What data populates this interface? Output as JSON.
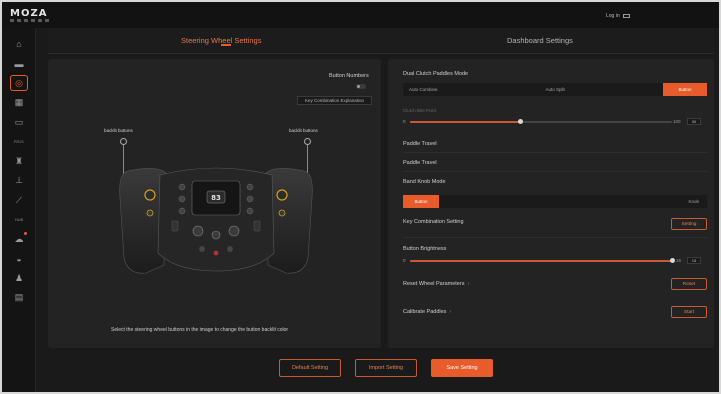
{
  "app": {
    "logo": "MOZA",
    "login": "Log in"
  },
  "sidebar": {
    "items": [
      {
        "icon": "home-icon",
        "glyph": "⌂",
        "label": ""
      },
      {
        "icon": "camera-icon",
        "glyph": "▬",
        "label": ""
      },
      {
        "icon": "steering-wheel-icon",
        "glyph": "◎",
        "label": "",
        "active": true
      },
      {
        "icon": "dashboard-icon",
        "glyph": "▦",
        "label": ""
      },
      {
        "icon": "display-icon",
        "glyph": "▭",
        "label": ""
      },
      {
        "icon": "base-icon",
        "glyph": "",
        "label": "RS21"
      },
      {
        "icon": "shifter-icon",
        "glyph": "♜",
        "label": ""
      },
      {
        "icon": "handbrake-icon",
        "glyph": "⊥",
        "label": ""
      },
      {
        "icon": "pedal-icon",
        "glyph": "⟋",
        "label": ""
      },
      {
        "icon": "hub-icon",
        "glyph": "",
        "label": "HUB"
      },
      {
        "icon": "cloud-icon",
        "glyph": "☁",
        "label": "",
        "badge": true
      },
      {
        "icon": "gear-knob-icon",
        "glyph": "◒",
        "label": ""
      },
      {
        "icon": "user-icon",
        "glyph": "♟",
        "label": ""
      },
      {
        "icon": "list-icon",
        "glyph": "▤",
        "label": ""
      }
    ]
  },
  "tabs": [
    {
      "label": "Steering Wheel Settings",
      "active": true
    },
    {
      "label": "Dashboard Settings",
      "active": false
    }
  ],
  "left_panel": {
    "button_numbers_label": "Button Numbers",
    "key_combination_explanation": "Key Combination Explanation",
    "backlit_left": "backlit buttons",
    "backlit_right": "backlit buttons",
    "display_value": "83",
    "hint": "Select the steering wheel buttons in the image to change the button backlit color"
  },
  "right_panel": {
    "dual_clutch_label": "Dual Clutch Paddles Mode",
    "dual_clutch_options": [
      "Auto Combine",
      "Auto Split",
      "Button"
    ],
    "dual_clutch_active": 2,
    "clutch_bite_label": "Clutch Bite Point",
    "clutch_bite_min": "0",
    "clutch_bite_max": "100",
    "clutch_bite_value": "30",
    "clutch_bite_percent": 42,
    "paddle_travel_1": "Paddle Travel",
    "paddle_travel_2": "Paddle Travel",
    "band_knob_label": "Band Knob Mode",
    "band_knob_options": [
      "Button",
      "Knob"
    ],
    "band_knob_active": 0,
    "key_combination_label": "Key Combination Setting",
    "key_combination_button": "Setting",
    "brightness_label": "Button Brightness",
    "brightness_min": "0",
    "brightness_max": "15",
    "brightness_value": "15",
    "brightness_percent": 100,
    "reset_label": "Reset Wheel Parameters",
    "reset_button": "Reset",
    "calibrate_label": "Calibrate Paddles",
    "calibrate_button": "Start"
  },
  "footer": {
    "default": "Default Setting",
    "import": "Import Setting",
    "save": "Save Setting"
  },
  "colors": {
    "accent": "#e85c2b",
    "panel": "#232323",
    "background": "#1a1a1a"
  }
}
